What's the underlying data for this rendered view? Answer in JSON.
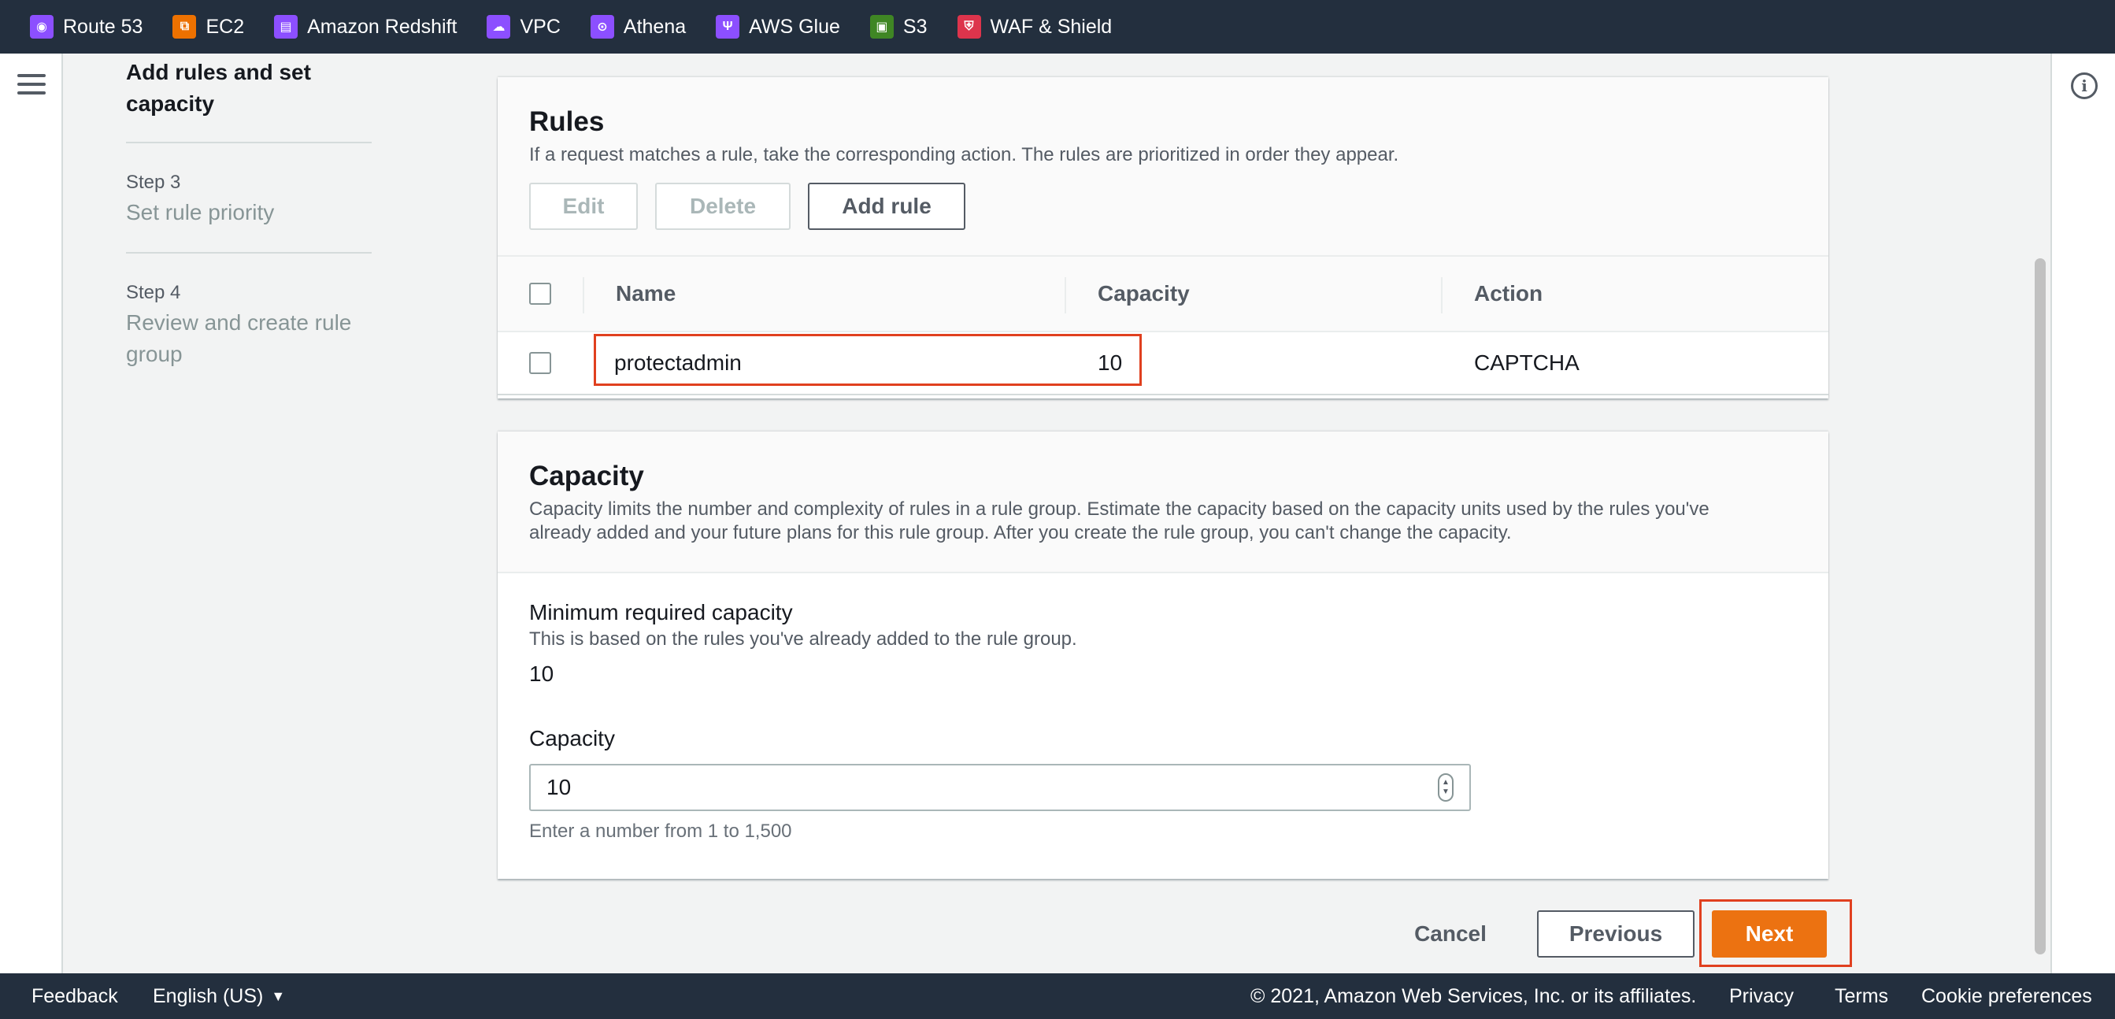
{
  "services": [
    {
      "label": "Route 53",
      "icon": "route53-icon",
      "color": "#8c4fff"
    },
    {
      "label": "EC2",
      "icon": "ec2-icon",
      "color": "#ed7100"
    },
    {
      "label": "Amazon Redshift",
      "icon": "redshift-icon",
      "color": "#8c4fff"
    },
    {
      "label": "VPC",
      "icon": "vpc-icon",
      "color": "#8c4fff"
    },
    {
      "label": "Athena",
      "icon": "athena-icon",
      "color": "#8c4fff"
    },
    {
      "label": "AWS Glue",
      "icon": "glue-icon",
      "color": "#8c4fff"
    },
    {
      "label": "S3",
      "icon": "s3-icon",
      "color": "#3f8624"
    },
    {
      "label": "WAF & Shield",
      "icon": "waf-shield-icon",
      "color": "#dd344c"
    }
  ],
  "steps": {
    "current_title": "Add rules and set capacity",
    "items": [
      {
        "num": "Step 3",
        "title": "Set rule priority"
      },
      {
        "num": "Step 4",
        "title": "Review and create rule group"
      }
    ]
  },
  "rules": {
    "title": "Rules",
    "description": "If a request matches a rule, take the corresponding action. The rules are prioritized in order they appear.",
    "buttons": {
      "edit": "Edit",
      "delete": "Delete",
      "add": "Add rule"
    },
    "columns": [
      "Name",
      "Capacity",
      "Action"
    ],
    "rows": [
      {
        "name": "protectadmin",
        "capacity": "10",
        "action": "CAPTCHA"
      }
    ]
  },
  "capacity": {
    "title": "Capacity",
    "description": "Capacity limits the number and complexity of rules in a rule group. Estimate the capacity based on the capacity units used by the rules you've already added and your future plans for this rule group. After you create the rule group, you can't change the capacity.",
    "min_label": "Minimum required capacity",
    "min_desc": "This is based on the rules you've already added to the rule group.",
    "min_value": "10",
    "input_label": "Capacity",
    "input_value": "10",
    "constraint": "Enter a number from 1 to 1,500"
  },
  "actions": {
    "cancel": "Cancel",
    "previous": "Previous",
    "next": "Next"
  },
  "footer": {
    "feedback": "Feedback",
    "language": "English (US)",
    "copyright": "© 2021, Amazon Web Services, Inc. or its affiliates.",
    "privacy": "Privacy",
    "terms": "Terms",
    "cookies": "Cookie preferences"
  },
  "colors": {
    "primary": "#ec7211",
    "highlight": "#e0401f",
    "nav_bg": "#232f3e"
  }
}
